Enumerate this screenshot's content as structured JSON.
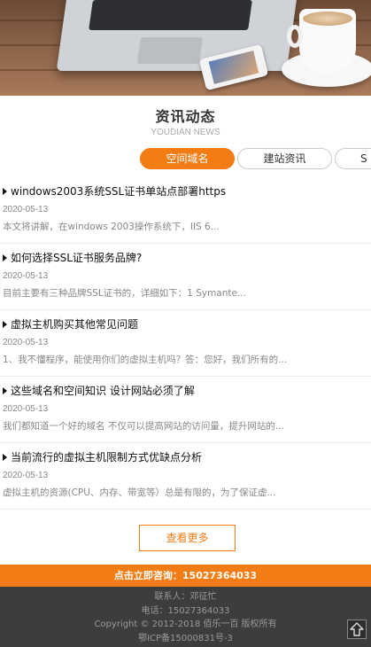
{
  "section": {
    "title": "资讯动态",
    "subtitle": "YOUDIAN NEWS"
  },
  "tabs": [
    {
      "label": "空间域名",
      "active": true
    },
    {
      "label": "建站资讯",
      "active": false
    },
    {
      "label": "S",
      "active": false
    }
  ],
  "news": [
    {
      "title": "windows2003系统SSL证书单站点部署https",
      "date": "2020-05-13",
      "desc": "本文将讲解，在windows 2003操作系统下，IIS 6..."
    },
    {
      "title": "如何选择SSL证书服务品牌?",
      "date": "2020-05-13",
      "desc": "目前主要有三种品牌SSL证书的，详细如下：1 Symante..."
    },
    {
      "title": "虚拟主机购买其他常见问题",
      "date": "2020-05-13",
      "desc": "1、我不懂程序，能使用你们的虚拟主机吗？答：您好，我们所有的..."
    },
    {
      "title": "这些域名和空间知识 设计网站必须了解",
      "date": "2020-05-13",
      "desc": "我们都知道一个好的域名 不仅可以提高网站的访问量，提升网站的..."
    },
    {
      "title": "当前流行的虚拟主机限制方式优缺点分析",
      "date": "2020-05-13",
      "desc": "虚拟主机的资源(CPU、内存、带宽等）总是有限的，为了保证虚..."
    }
  ],
  "more_label": "查看更多",
  "consult_label": "点击立即咨询：15027364033",
  "footer": {
    "contact": "联系人：邓征忙",
    "phone": "电话：15027364033",
    "copyright": "Copyright © 2012-2018 佰乐一百 版权所有",
    "icp": "鄂ICP备15000831号-3"
  },
  "icons": {
    "back_to_top": "arrow-up-icon",
    "bullet": "triangle-right-icon"
  },
  "colors": {
    "accent": "#f47c14",
    "footer_bg": "#3d3d3d"
  }
}
